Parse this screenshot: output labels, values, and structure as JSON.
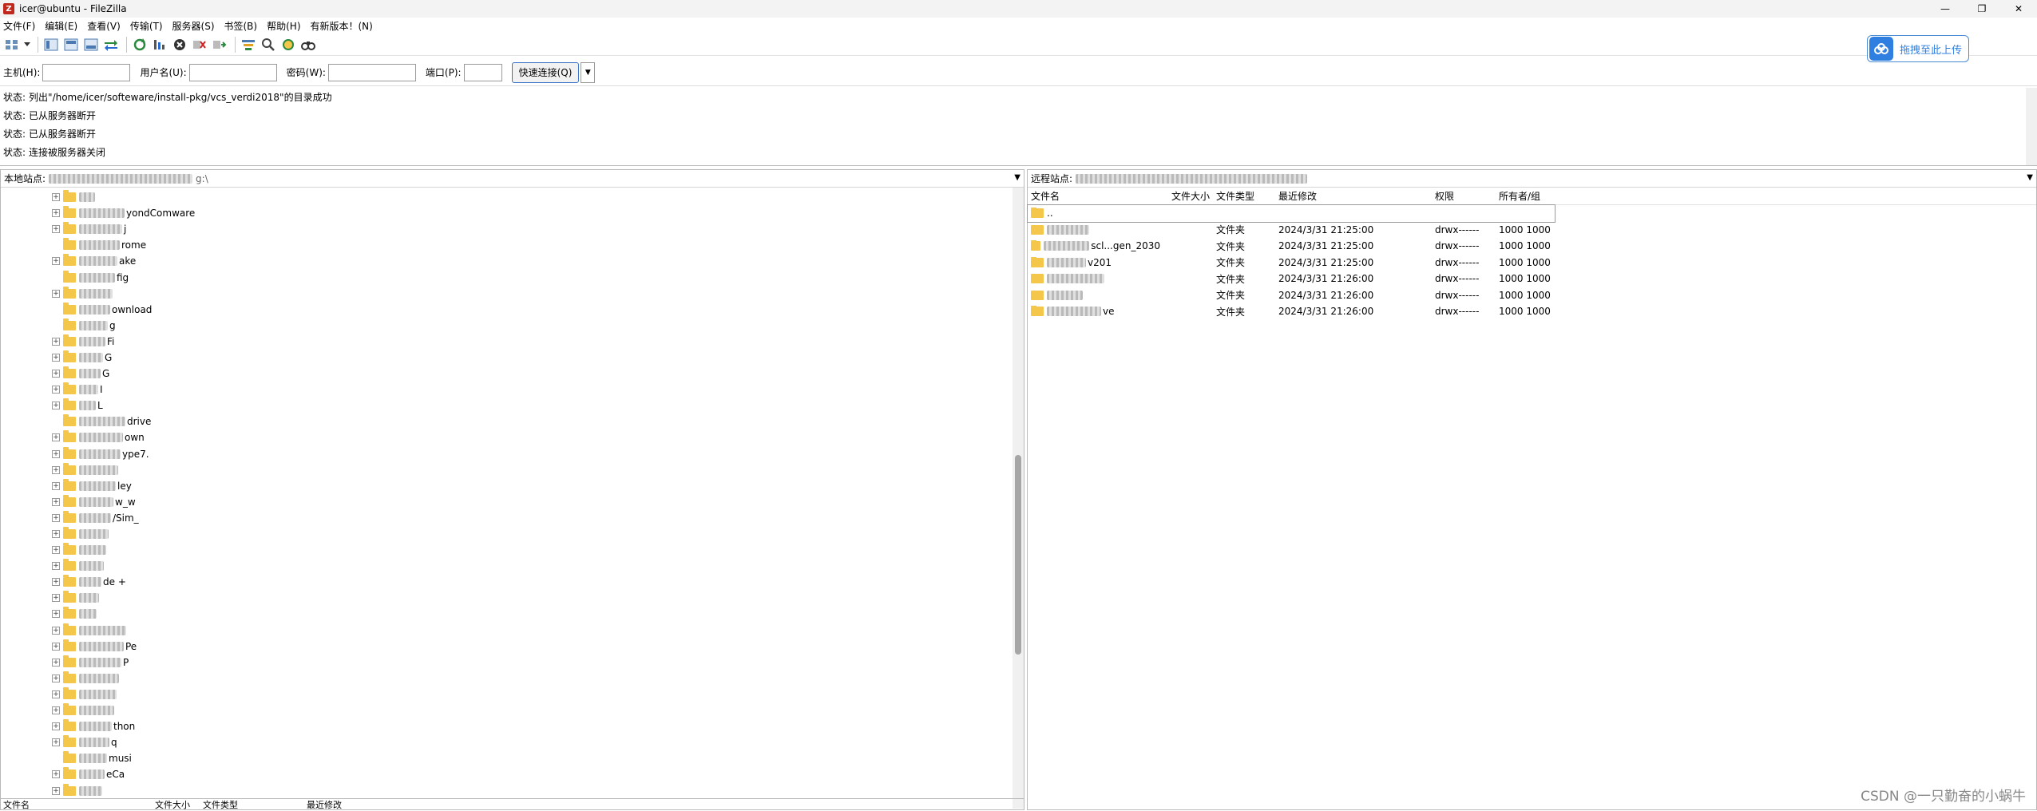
{
  "window": {
    "title": "icer@ubuntu - FileZilla",
    "min": "—",
    "max": "❐",
    "close": "✕"
  },
  "menu": [
    "文件(F)",
    "编辑(E)",
    "查看(V)",
    "传输(T)",
    "服务器(S)",
    "书签(B)",
    "帮助(H)",
    "有新版本！(N)"
  ],
  "upload": {
    "label": "拖拽至此上传"
  },
  "quickconnect": {
    "host_label": "主机(H):",
    "user_label": "用户名(U):",
    "pass_label": "密码(W):",
    "port_label": "端口(P):",
    "connect_label": "快速连接(Q)",
    "host_value": "",
    "user_value": "",
    "pass_value": "",
    "port_value": ""
  },
  "log": [
    {
      "label": "状态:",
      "text": "列出\"/home/icer/softeware/install-pkg/vcs_verdi2018\"的目录成功"
    },
    {
      "label": "状态:",
      "text": "已从服务器断开"
    },
    {
      "label": "状态:",
      "text": "已从服务器断开"
    },
    {
      "label": "状态:",
      "text": "连接被服务器关闭"
    }
  ],
  "local": {
    "path_label": "本地站点:",
    "path_value": "g:\\",
    "tree": [
      {
        "name": "",
        "exp": "+"
      },
      {
        "name": "yondComware",
        "exp": "+"
      },
      {
        "name": "j",
        "exp": "+"
      },
      {
        "name": "rome",
        "exp": ""
      },
      {
        "name": "ake",
        "exp": "+"
      },
      {
        "name": "fig",
        "exp": ""
      },
      {
        "name": "",
        "exp": "+"
      },
      {
        "name": "ownload",
        "exp": ""
      },
      {
        "name": "g",
        "exp": ""
      },
      {
        "name": "Fi",
        "exp": "+"
      },
      {
        "name": "G",
        "exp": "+"
      },
      {
        "name": "G",
        "exp": "+"
      },
      {
        "name": "I",
        "exp": "+"
      },
      {
        "name": "L",
        "exp": "+"
      },
      {
        "name": "drive",
        "exp": ""
      },
      {
        "name": "own",
        "exp": "+"
      },
      {
        "name": "ype7.",
        "exp": "+"
      },
      {
        "name": "",
        "exp": "+"
      },
      {
        "name": "ley",
        "exp": "+"
      },
      {
        "name": "w_w",
        "exp": "+"
      },
      {
        "name": "/Sim_",
        "exp": "+"
      },
      {
        "name": "",
        "exp": "+"
      },
      {
        "name": "",
        "exp": "+"
      },
      {
        "name": "",
        "exp": "+"
      },
      {
        "name": "de +",
        "exp": "+"
      },
      {
        "name": "",
        "exp": "+"
      },
      {
        "name": "",
        "exp": "+"
      },
      {
        "name": "",
        "exp": "+"
      },
      {
        "name": "Pe",
        "exp": "+"
      },
      {
        "name": "P",
        "exp": "+"
      },
      {
        "name": "",
        "exp": "+"
      },
      {
        "name": "",
        "exp": "+"
      },
      {
        "name": "",
        "exp": "+"
      },
      {
        "name": "thon",
        "exp": "+"
      },
      {
        "name": "q",
        "exp": "+"
      },
      {
        "name": "musi",
        "exp": ""
      },
      {
        "name": "eCa",
        "exp": "+"
      },
      {
        "name": "",
        "exp": "+"
      }
    ],
    "columns": [
      "文件名",
      "文件大小",
      "文件类型",
      "最近修改"
    ]
  },
  "remote": {
    "path_label": "远程站点:",
    "path_value": "",
    "columns": [
      "文件名",
      "文件大小",
      "文件类型",
      "最近修改",
      "权限",
      "所有者/组"
    ],
    "rows": [
      {
        "name": "..",
        "size": "",
        "type": "",
        "modified": "",
        "perm": "",
        "owner": ""
      },
      {
        "name": "",
        "size": "",
        "type": "文件夹",
        "modified": "2024/3/31 21:25:00",
        "perm": "drwx------",
        "owner": "1000 1000"
      },
      {
        "name": "scl...gen_2030",
        "size": "",
        "type": "文件夹",
        "modified": "2024/3/31 21:25:00",
        "perm": "drwx------",
        "owner": "1000 1000"
      },
      {
        "name": "v201",
        "size": "",
        "type": "文件夹",
        "modified": "2024/3/31 21:25:00",
        "perm": "drwx------",
        "owner": "1000 1000"
      },
      {
        "name": "",
        "size": "",
        "type": "文件夹",
        "modified": "2024/3/31 21:26:00",
        "perm": "drwx------",
        "owner": "1000 1000"
      },
      {
        "name": "",
        "size": "",
        "type": "文件夹",
        "modified": "2024/3/31 21:26:00",
        "perm": "drwx------",
        "owner": "1000 1000"
      },
      {
        "name": "ve",
        "size": "",
        "type": "文件夹",
        "modified": "2024/3/31 21:26:00",
        "perm": "drwx------",
        "owner": "1000 1000"
      }
    ]
  },
  "watermark": "CSDN @一只勤奋的小蜗牛"
}
